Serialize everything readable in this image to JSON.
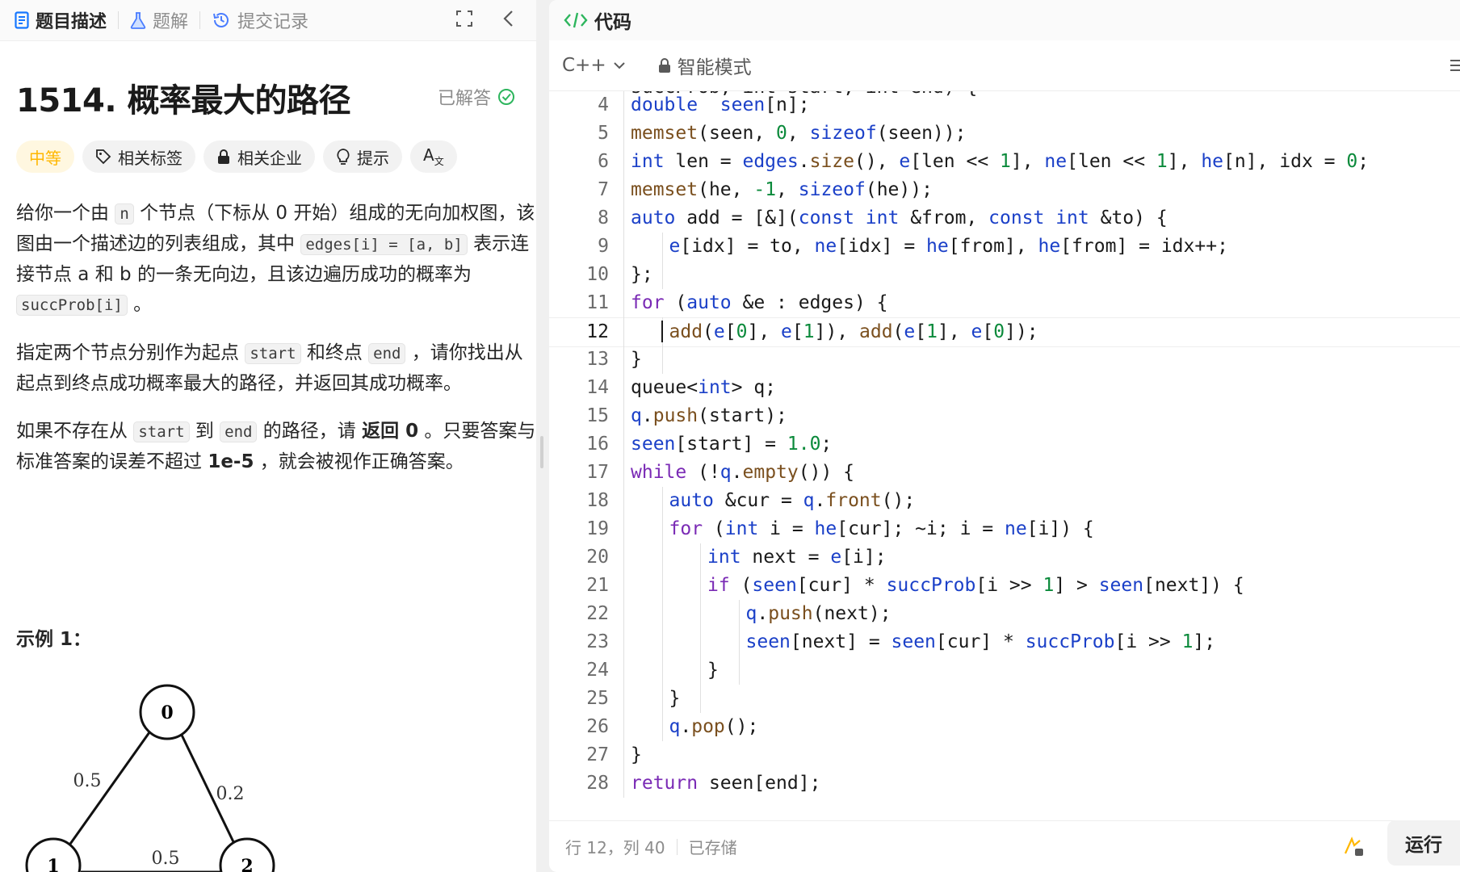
{
  "left_tabs": [
    {
      "label": "题目描述",
      "icon": "document-icon",
      "active": true
    },
    {
      "label": "题解",
      "icon": "flask-icon",
      "active": false
    },
    {
      "label": "提交记录",
      "icon": "history-icon",
      "active": false
    }
  ],
  "problem": {
    "title": "1514. 概率最大的路径",
    "status": "已解答",
    "tags": [
      "中等",
      "相关标签",
      "相关企业",
      "提示",
      "A"
    ],
    "desc": {
      "p1": [
        "给你一个由 ",
        "n",
        " 个节点（下标从 0 开始）组成的无向加权图，该图由一个描述边的列表组成，其中 ",
        "edges[i] = [a, b]",
        " 表示连接节点 a 和 b 的一条无向边，且该边遍历成功的概率为 ",
        "succProb[i]",
        " 。"
      ],
      "p2": [
        "指定两个节点分别作为起点 ",
        "start",
        " 和终点 ",
        "end",
        " ，请你找出从起点到终点成功概率最大的路径，并返回其成功概率。"
      ],
      "p3": [
        "如果不存在从 ",
        "start",
        " 到 ",
        "end",
        " 的路径，请 ",
        "返回 0",
        " 。只要答案与标准答案的误差不超过 ",
        "1e-5",
        " ，就会被视作正确答案。"
      ]
    },
    "example_title": "示例 1：",
    "graph": {
      "nodes": [
        "0",
        "1",
        "2"
      ],
      "edge_labels": [
        "0.5",
        "0.2",
        "0.5"
      ]
    }
  },
  "editor": {
    "header": "代码",
    "language": "C++",
    "mode": "智能模式",
    "lines": [
      {
        "n": "4",
        "indent": 1,
        "t": [
          [
            "ty",
            "double"
          ],
          [
            "",
            "  "
          ],
          [
            "vr",
            "seen"
          ],
          [
            "",
            "[n];"
          ]
        ]
      },
      {
        "n": "5",
        "indent": 1,
        "t": [
          [
            "fn",
            "memset"
          ],
          [
            "",
            "(seen, "
          ],
          [
            "nm",
            "0"
          ],
          [
            "",
            ", "
          ],
          [
            "ty",
            "sizeof"
          ],
          [
            "",
            "(seen));"
          ]
        ]
      },
      {
        "n": "6",
        "indent": 1,
        "t": [
          [
            "ty",
            "int"
          ],
          [
            "",
            " len = "
          ],
          [
            "vr",
            "edges"
          ],
          [
            "",
            "."
          ],
          [
            "fn",
            "size"
          ],
          [
            "",
            "(), "
          ],
          [
            "vr",
            "e"
          ],
          [
            "",
            "[len << "
          ],
          [
            "nm",
            "1"
          ],
          [
            "",
            "], "
          ],
          [
            "vr",
            "ne"
          ],
          [
            "",
            "[len << "
          ],
          [
            "nm",
            "1"
          ],
          [
            "",
            "], "
          ],
          [
            "vr",
            "he"
          ],
          [
            "",
            "[n], idx = "
          ],
          [
            "nm",
            "0"
          ],
          [
            "",
            ";"
          ]
        ]
      },
      {
        "n": "7",
        "indent": 1,
        "t": [
          [
            "fn",
            "memset"
          ],
          [
            "",
            "(he, "
          ],
          [
            "nm",
            "-1"
          ],
          [
            "",
            ", "
          ],
          [
            "ty",
            "sizeof"
          ],
          [
            "",
            "(he));"
          ]
        ]
      },
      {
        "n": "8",
        "indent": 1,
        "t": [
          [
            "ty",
            "auto"
          ],
          [
            "",
            " add = [&]("
          ],
          [
            "ty",
            "const int"
          ],
          [
            "",
            " &from, "
          ],
          [
            "ty",
            "const int"
          ],
          [
            "",
            " &to) {"
          ]
        ]
      },
      {
        "n": "9",
        "indent": 2,
        "t": [
          [
            "vr",
            "e"
          ],
          [
            "",
            "[idx] = to, "
          ],
          [
            "vr",
            "ne"
          ],
          [
            "",
            "[idx] = "
          ],
          [
            "vr",
            "he"
          ],
          [
            "",
            "[from], "
          ],
          [
            "vr",
            "he"
          ],
          [
            "",
            "[from] = idx++;"
          ]
        ]
      },
      {
        "n": "10",
        "indent": 1,
        "t": [
          [
            "",
            "};"
          ]
        ]
      },
      {
        "n": "11",
        "indent": 1,
        "t": [
          [
            "kw",
            "for"
          ],
          [
            "",
            " ("
          ],
          [
            "ty",
            "auto"
          ],
          [
            "",
            " &e : edges) {"
          ]
        ]
      },
      {
        "n": "12",
        "indent": 2,
        "t": [
          [
            "fn",
            "add"
          ],
          [
            "",
            "("
          ],
          [
            "vr",
            "e"
          ],
          [
            "",
            "["
          ],
          [
            "nm",
            "0"
          ],
          [
            "",
            "], "
          ],
          [
            "vr",
            "e"
          ],
          [
            "",
            "["
          ],
          [
            "nm",
            "1"
          ],
          [
            "",
            "]), "
          ],
          [
            "fn",
            "add"
          ],
          [
            "",
            "("
          ],
          [
            "vr",
            "e"
          ],
          [
            "",
            "["
          ],
          [
            "nm",
            "1"
          ],
          [
            "",
            "], "
          ],
          [
            "vr",
            "e"
          ],
          [
            "",
            "["
          ],
          [
            "nm",
            "0"
          ],
          [
            "",
            "]);"
          ]
        ]
      },
      {
        "n": "13",
        "indent": 1,
        "t": [
          [
            "",
            "}"
          ]
        ]
      },
      {
        "n": "14",
        "indent": 1,
        "t": [
          [
            "",
            "queue<"
          ],
          [
            "ty",
            "int"
          ],
          [
            "",
            "> q;"
          ]
        ]
      },
      {
        "n": "15",
        "indent": 1,
        "t": [
          [
            "vr",
            "q"
          ],
          [
            "",
            "."
          ],
          [
            "fn",
            "push"
          ],
          [
            "",
            "(start);"
          ]
        ]
      },
      {
        "n": "16",
        "indent": 1,
        "t": [
          [
            "vr",
            "seen"
          ],
          [
            "",
            "[start] = "
          ],
          [
            "nm",
            "1.0"
          ],
          [
            "",
            ";"
          ]
        ]
      },
      {
        "n": "17",
        "indent": 1,
        "t": [
          [
            "kw",
            "while"
          ],
          [
            "",
            " (!"
          ],
          [
            "vr",
            "q"
          ],
          [
            "",
            "."
          ],
          [
            "fn",
            "empty"
          ],
          [
            "",
            "()) {"
          ]
        ]
      },
      {
        "n": "18",
        "indent": 2,
        "t": [
          [
            "ty",
            "auto"
          ],
          [
            "",
            " &cur = "
          ],
          [
            "vr",
            "q"
          ],
          [
            "",
            "."
          ],
          [
            "fn",
            "front"
          ],
          [
            "",
            "();"
          ]
        ]
      },
      {
        "n": "19",
        "indent": 2,
        "t": [
          [
            "kw",
            "for"
          ],
          [
            "",
            " ("
          ],
          [
            "ty",
            "int"
          ],
          [
            "",
            " i = "
          ],
          [
            "vr",
            "he"
          ],
          [
            "",
            "[cur]; ~i; i = "
          ],
          [
            "vr",
            "ne"
          ],
          [
            "",
            "[i]) {"
          ]
        ]
      },
      {
        "n": "20",
        "indent": 3,
        "t": [
          [
            "ty",
            "int"
          ],
          [
            "",
            " next = "
          ],
          [
            "vr",
            "e"
          ],
          [
            "",
            "[i];"
          ]
        ]
      },
      {
        "n": "21",
        "indent": 3,
        "t": [
          [
            "kw",
            "if"
          ],
          [
            "",
            " ("
          ],
          [
            "vr",
            "seen"
          ],
          [
            "",
            "[cur] * "
          ],
          [
            "vr",
            "succProb"
          ],
          [
            "",
            "[i >> "
          ],
          [
            "nm",
            "1"
          ],
          [
            "",
            "] > "
          ],
          [
            "vr",
            "seen"
          ],
          [
            "",
            "[next]) {"
          ]
        ]
      },
      {
        "n": "22",
        "indent": 4,
        "t": [
          [
            "vr",
            "q"
          ],
          [
            "",
            "."
          ],
          [
            "fn",
            "push"
          ],
          [
            "",
            "(next);"
          ]
        ]
      },
      {
        "n": "23",
        "indent": 4,
        "t": [
          [
            "vr",
            "seen"
          ],
          [
            "",
            "[next] = "
          ],
          [
            "vr",
            "seen"
          ],
          [
            "",
            "[cur] * "
          ],
          [
            "vr",
            "succProb"
          ],
          [
            "",
            "[i >> "
          ],
          [
            "nm",
            "1"
          ],
          [
            "",
            "];"
          ]
        ]
      },
      {
        "n": "24",
        "indent": 3,
        "t": [
          [
            "",
            "}"
          ]
        ]
      },
      {
        "n": "25",
        "indent": 2,
        "t": [
          [
            "",
            "}"
          ]
        ]
      },
      {
        "n": "26",
        "indent": 2,
        "t": [
          [
            "vr",
            "q"
          ],
          [
            "",
            "."
          ],
          [
            "fn",
            "pop"
          ],
          [
            "",
            "();"
          ]
        ]
      },
      {
        "n": "27",
        "indent": 1,
        "t": [
          [
            "",
            "}"
          ]
        ]
      },
      {
        "n": "28",
        "indent": 1,
        "t": [
          [
            "kw",
            "return"
          ],
          [
            "",
            " seen[end];"
          ]
        ]
      }
    ],
    "status_pos": "行 12，列 40",
    "status_saved": "已存储",
    "run_label": "运行"
  }
}
